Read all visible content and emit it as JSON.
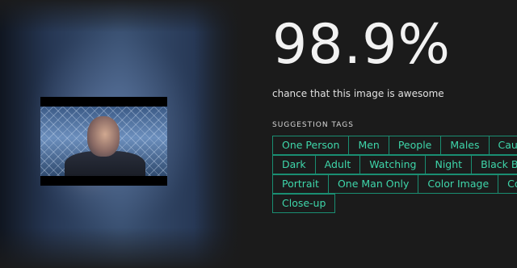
{
  "result": {
    "score": "98.9%",
    "subtitle": "chance that this image is awesome"
  },
  "tags_section": {
    "heading": "SUGGESTION TAGS",
    "rows": [
      [
        "One Person",
        "Men",
        "People",
        "Males",
        "Cau"
      ],
      [
        "Dark",
        "Adult",
        "Watching",
        "Night",
        "Black B"
      ],
      [
        "Portrait",
        "One Man Only",
        "Color Image",
        "Co"
      ],
      [
        "Close-up"
      ]
    ]
  },
  "colors": {
    "background": "#1b1b1b",
    "tag_text": "#3ed6aa",
    "tag_border": "#1a8e72"
  }
}
